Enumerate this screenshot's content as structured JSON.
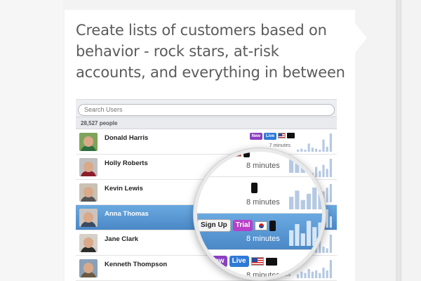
{
  "headline": "Create lists of customers based on behavior - rock stars, at-risk accounts, and everything in between",
  "search": {
    "placeholder": "Search Users"
  },
  "people_count": "28,527 people",
  "users": [
    {
      "name": "Donald Harris",
      "badges": [
        "New",
        "Live"
      ],
      "flag": "us",
      "device": "monitor",
      "time": "7 minutes",
      "shirt": "#2d6e3e",
      "bg": "#7fa35a",
      "spark": [
        2,
        3,
        2,
        8,
        4,
        3,
        2,
        12,
        5,
        18
      ]
    },
    {
      "name": "Holly Roberts",
      "badges": [
        "Live"
      ],
      "flag": "ca",
      "device": "phone",
      "time": "8 minutes",
      "shirt": "#8b1d2a",
      "bg": "#c0c0c0",
      "spark": [
        3,
        2,
        4,
        3,
        2,
        5,
        3,
        6,
        4,
        9
      ]
    },
    {
      "name": "Kevin Lewis",
      "badges": [],
      "flag": "",
      "device": "phone",
      "time": "8 minutes",
      "shirt": "#555555",
      "bg": "#c8c1b4",
      "spark": [
        4,
        6,
        3,
        5,
        4,
        7,
        5,
        6,
        8,
        10
      ]
    },
    {
      "name": "Anna Thomas",
      "badges": [
        "Sign Up",
        "Trial"
      ],
      "flag": "kr",
      "device": "phone",
      "time": "8 minutes",
      "shirt": "#3a4b63",
      "bg": "#c9c4c0",
      "spark": [
        10,
        14,
        8,
        16,
        12,
        9,
        15,
        7,
        18,
        11
      ]
    },
    {
      "name": "Jane Clark",
      "badges": [
        "New",
        "Live"
      ],
      "flag": "us",
      "device": "monitor",
      "time": "8 minutes",
      "shirt": "#2c2c2c",
      "bg": "#d5d0c8",
      "spark": [
        2,
        4,
        3,
        6,
        2,
        5,
        8,
        4,
        3,
        12
      ]
    },
    {
      "name": "Kenneth Thompson",
      "badges": [],
      "flag": "us",
      "device": "monitor",
      "time": "8 minutes",
      "shirt": "#6b5a43",
      "bg": "#8aa0b8",
      "spark": [
        3,
        5,
        4,
        7,
        5,
        6,
        4,
        8,
        6,
        14
      ]
    }
  ],
  "magnifier": {
    "rows": [
      {
        "badges": [
          "Live"
        ],
        "flag": "ca",
        "device": "phone",
        "time": "8 minutes",
        "spark": [
          3,
          2,
          4,
          3,
          5,
          3,
          6
        ]
      },
      {
        "badges": [],
        "flag": "",
        "device": "phone",
        "time": "8 minutes",
        "spark": [
          4,
          6,
          3,
          5,
          7,
          5,
          9
        ]
      },
      {
        "badges": [
          "Sign Up",
          "Trial"
        ],
        "flag": "kr",
        "device": "phone",
        "time": "8 minutes",
        "spark": [
          10,
          14,
          8,
          16,
          12,
          15,
          18
        ]
      },
      {
        "badges": [
          "New",
          "Live"
        ],
        "flag": "us",
        "device": "monitor",
        "time": "8 minutes",
        "spark": [
          2,
          4,
          3,
          6,
          5,
          8,
          12
        ]
      }
    ]
  },
  "colors": {
    "badge_new": "#8a3fc1",
    "badge_live": "#2f7ad6",
    "badge_trial": "#b83fc8",
    "selected_row": "#5b9bd5"
  }
}
